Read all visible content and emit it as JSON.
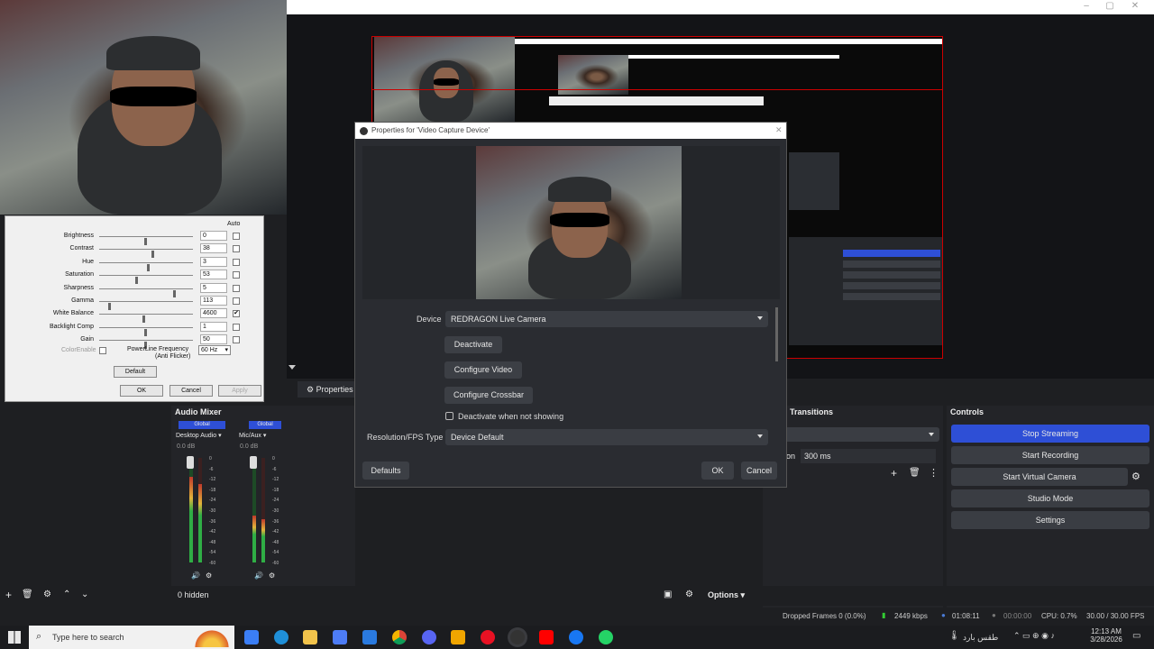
{
  "adv_dialog": {
    "header": "Auto",
    "settings": [
      {
        "label": "Brightness",
        "value": "0",
        "slider": 0.5,
        "auto": false
      },
      {
        "label": "Contrast",
        "value": "38",
        "slider": 0.58,
        "auto": false
      },
      {
        "label": "Hue",
        "value": "3",
        "slider": 0.53,
        "auto": false
      },
      {
        "label": "Saturation",
        "value": "53",
        "slider": 0.4,
        "auto": false
      },
      {
        "label": "Sharpness",
        "value": "5",
        "slider": 0.82,
        "auto": false
      },
      {
        "label": "Gamma",
        "value": "113",
        "slider": 0.1,
        "auto": false
      },
      {
        "label": "White Balance",
        "value": "4600",
        "slider": 0.48,
        "auto": true
      },
      {
        "label": "Backlight Comp",
        "value": "1",
        "slider": 0.5,
        "auto": false
      },
      {
        "label": "Gain",
        "value": "50",
        "slider": 0.5,
        "auto": false
      }
    ],
    "color_enable": "ColorEnable",
    "powerline_label": "PowerLine Frequency",
    "powerline_sub": "(Anti Flicker)",
    "powerline_value": "60 Hz",
    "default": "Default",
    "ok": "OK",
    "cancel": "Cancel",
    "apply": "Apply"
  },
  "properties_dialog": {
    "title": "Properties for 'Video Capture Device'",
    "device_label": "Device",
    "device_value": "REDRAGON Live Camera",
    "deactivate": "Deactivate",
    "configure_video": "Configure Video",
    "configure_crossbar": "Configure Crossbar",
    "deactivate_when": "Deactivate when not showing",
    "resfps_label": "Resolution/FPS Type",
    "resfps_value": "Device Default",
    "defaults": "Defaults",
    "ok": "OK",
    "cancel": "Cancel"
  },
  "properties_tab": "Properties",
  "mixer": {
    "title": "Audio Mixer",
    "channels": [
      {
        "scope": "Global",
        "name": "Desktop Audio",
        "db": "0.0 dB",
        "level": 0.82
      },
      {
        "scope": "Global",
        "name": "Mic/Aux",
        "db": "0.0 dB",
        "level": 0.45
      }
    ],
    "db_scale": [
      "0",
      "-6",
      "-12",
      "-18",
      "-24",
      "-30",
      "-36",
      "-42",
      "-48",
      "-54",
      "-60"
    ]
  },
  "transitions": {
    "title": "Transitions",
    "duration_label": "on",
    "duration": "300 ms"
  },
  "controls": {
    "title": "Controls",
    "buttons": [
      "Stop Streaming",
      "Start Recording",
      "Start Virtual Camera",
      "Studio Mode",
      "Settings"
    ]
  },
  "scene_bar": {
    "hidden": "0 hidden",
    "options": "Options"
  },
  "status": {
    "dropped": "Dropped Frames 0 (0.0%)",
    "kbps": "2449 kbps",
    "live": "01:08:11",
    "rec": "00:00:00",
    "cpu": "CPU: 0.7%",
    "fps": "30.00 / 30.00 FPS"
  },
  "taskbar": {
    "search": "Type here to search",
    "weather": "طقس بارد",
    "time": "12:13 AM",
    "date": "3/28/2026"
  },
  "colors": {
    "accent": "#2e4fd6",
    "red": "#cc0000"
  }
}
